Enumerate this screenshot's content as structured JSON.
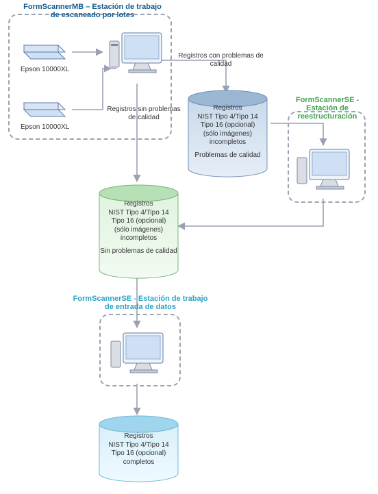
{
  "stations": {
    "batch": {
      "title": "FormScannerMB – Estación de trabajo de escaneado por lotes"
    },
    "restruct": {
      "title": "FormScannerSE - Estación de reestructuración"
    },
    "entry": {
      "title": "FormScannerSE - Estación de trabajo de entrada de datos"
    }
  },
  "devices": {
    "scanner1_label": "Epson 10000XL",
    "scanner2_label": "Epson 10000XL"
  },
  "edges": {
    "with_problems": "Registros con problemas de calidad",
    "no_problems": "Registros sin problemas de calidad"
  },
  "cylinders": {
    "problems": {
      "l1": "Registros",
      "l2": "NIST Tipo 4/Tipo 14",
      "l3": "Tipo 16 (opcional)",
      "l4": "(sólo imágenes)",
      "l5": "incompletos",
      "l6": "Problemas de calidad"
    },
    "ok": {
      "l1": "Registros",
      "l2": "NIST Tipo 4/Tipo 14",
      "l3": "Tipo 16 (opcional)",
      "l4": "(sólo imágenes)",
      "l5": "incompletos",
      "l6": "Sin problemas de calidad"
    },
    "final": {
      "l1": "Registros",
      "l2": "NIST Tipo 4/Tipo 14",
      "l3": "Tipo 16 (opcional)",
      "l4": "completos"
    }
  },
  "colors": {
    "arrow": "#9aa2b1",
    "cyl_problems_top": "#9bb7d4",
    "cyl_problems_bot": "#c9d9ea",
    "cyl_ok_top": "#b7e0b7",
    "cyl_ok_bot": "#e0f3e0",
    "cyl_final_top": "#9fd6ee",
    "cyl_final_bot": "#d8eff9"
  }
}
